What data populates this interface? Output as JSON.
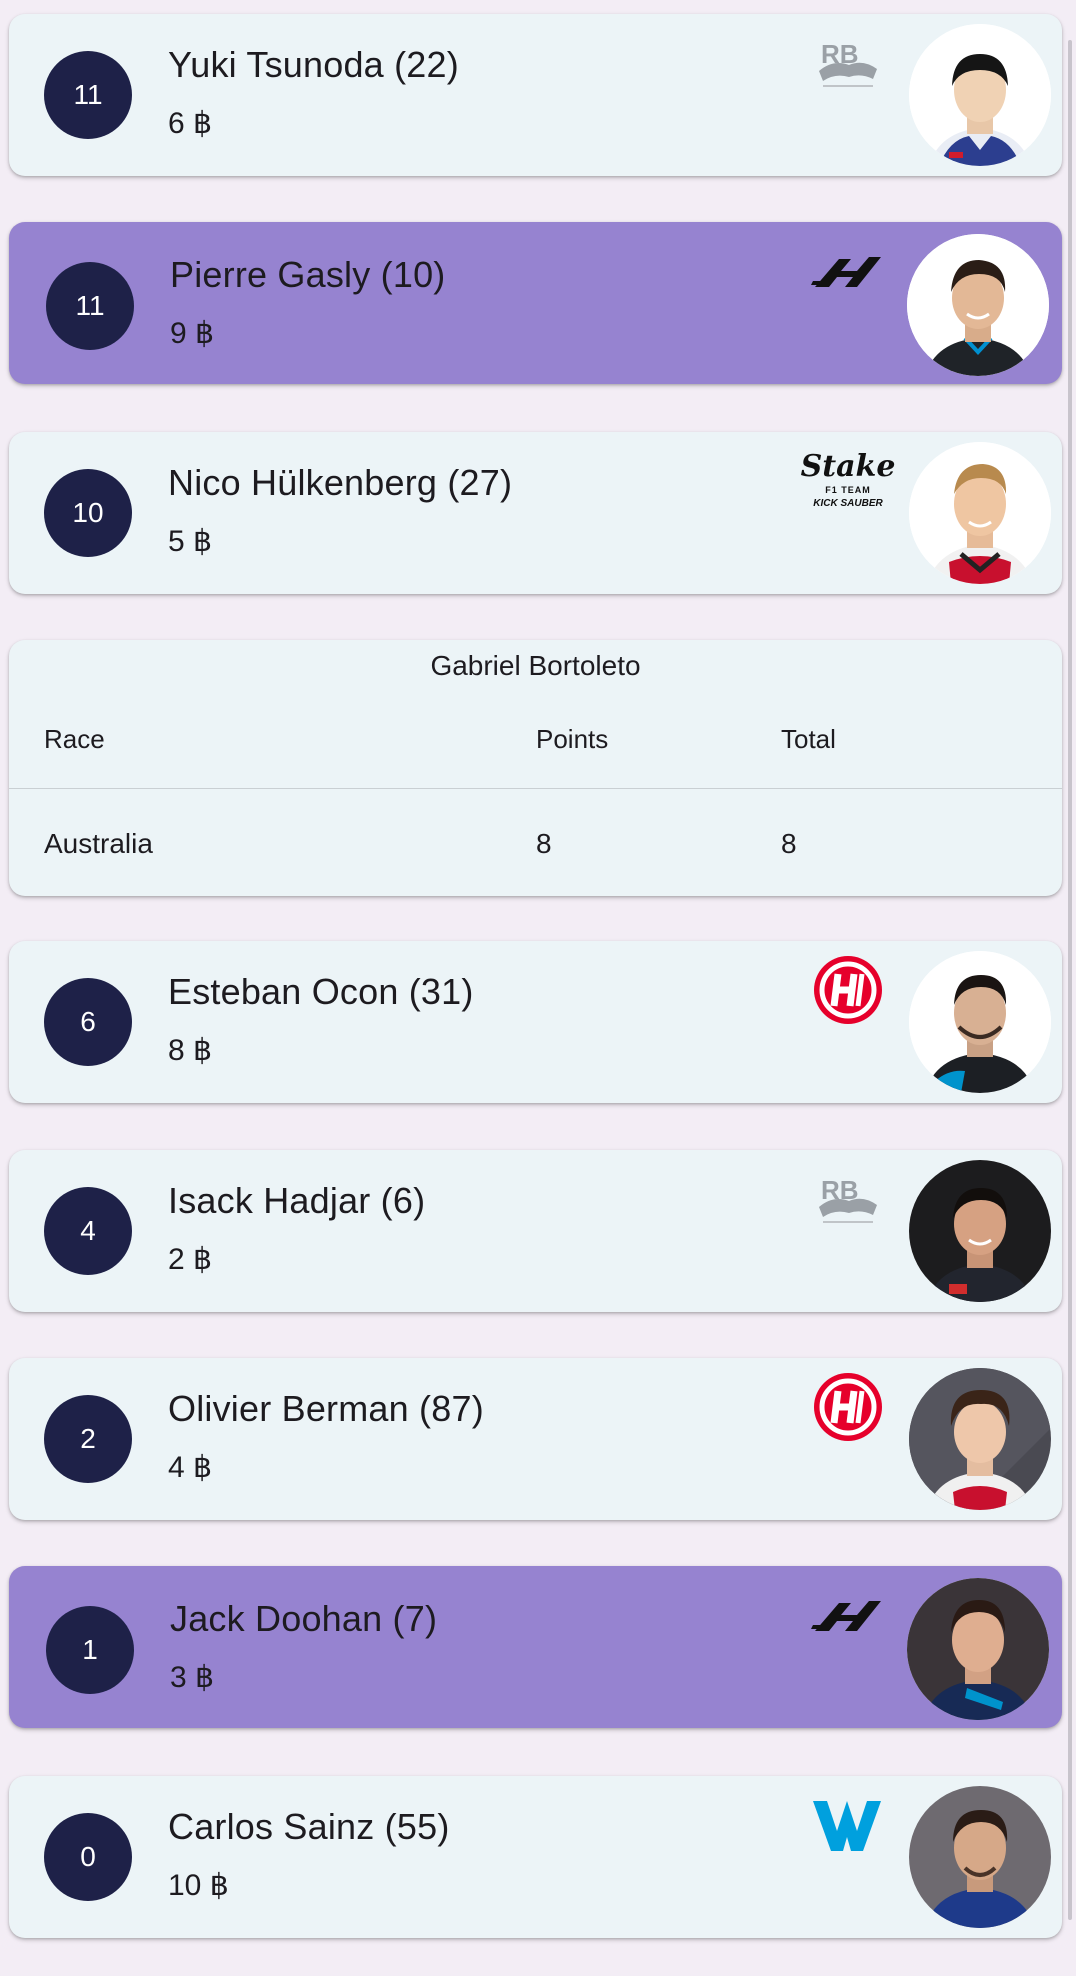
{
  "drivers": [
    {
      "position": "11",
      "name": "Yuki Tsunoda (22)",
      "price": "6 ฿",
      "team": "rb",
      "selected": false
    },
    {
      "position": "11",
      "name": "Pierre Gasly (10)",
      "price": "9 ฿",
      "team": "alpine",
      "selected": true
    },
    {
      "position": "10",
      "name": "Nico Hülkenberg (27)",
      "price": "5 ฿",
      "team": "sauber",
      "selected": false
    },
    {
      "position": "6",
      "name": "Esteban Ocon (31)",
      "price": "8 ฿",
      "team": "haas",
      "selected": false
    },
    {
      "position": "4",
      "name": "Isack Hadjar (6)",
      "price": "2 ฿",
      "team": "rb",
      "selected": false
    },
    {
      "position": "2",
      "name": "Olivier Berman (87)",
      "price": "4 ฿",
      "team": "haas",
      "selected": false
    },
    {
      "position": "1",
      "name": "Jack Doohan (7)",
      "price": "3 ฿",
      "team": "alpine",
      "selected": true
    },
    {
      "position": "0",
      "name": "Carlos Sainz (55)",
      "price": "10 ฿",
      "team": "williams",
      "selected": false
    }
  ],
  "detail": {
    "title": "Gabriel Bortoleto",
    "headers": [
      "Race",
      "Points",
      "Total"
    ],
    "rows": [
      [
        "Australia",
        "8",
        "8"
      ]
    ]
  },
  "logos": {
    "sauber": {
      "line1": "Stake",
      "line2": "F1 TEAM",
      "line3": "KICK SAUBER"
    },
    "rb": {
      "text": "RB"
    }
  },
  "colors": {
    "card": "#ecf4f7",
    "selected_card": "#9683d0",
    "badge": "#1e2148",
    "haas_red": "#e6002b",
    "williams_blue": "#00a0de"
  },
  "icons": {
    "rb": "racing-bulls-logo-icon",
    "alpine": "alpine-logo-icon",
    "sauber": "stake-sauber-logo-icon",
    "haas": "haas-logo-icon",
    "williams": "williams-logo-icon"
  }
}
